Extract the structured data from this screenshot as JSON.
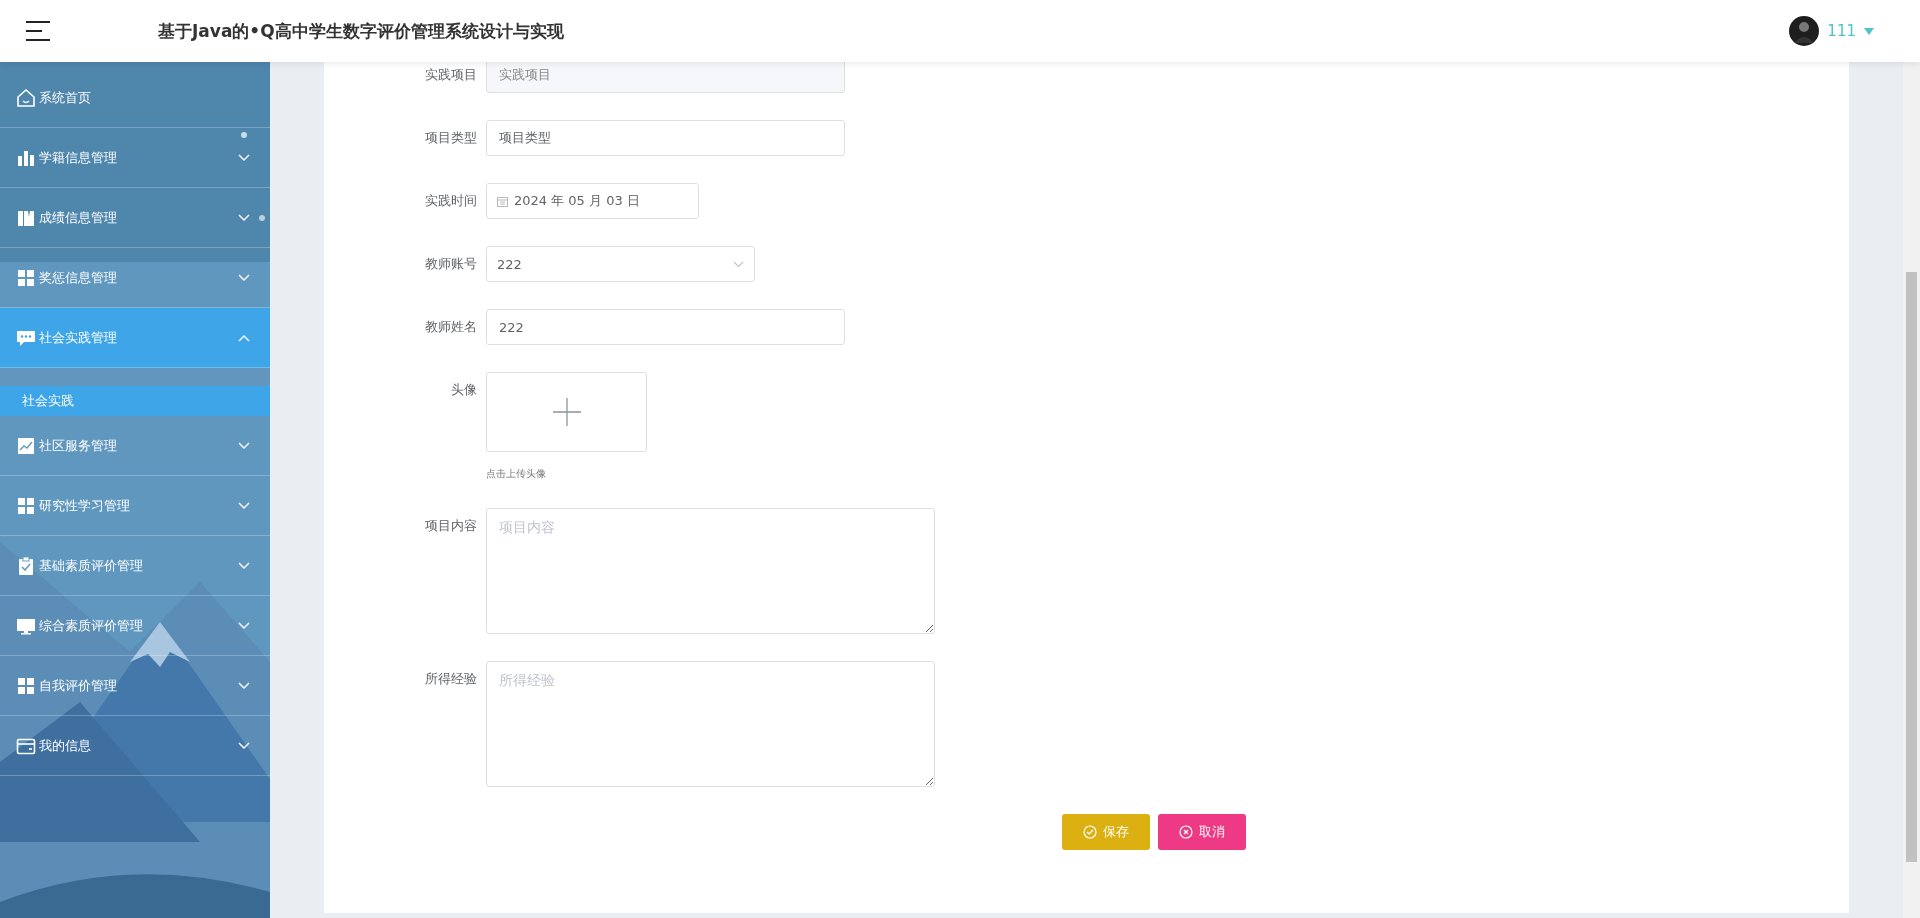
{
  "header": {
    "title": "基于Java的•Q高中学生数字评价管理系统设计与实现",
    "user": {
      "name": "111"
    }
  },
  "sidebar": {
    "items": [
      {
        "label": "系统首页",
        "kind": "link",
        "selected": false
      },
      {
        "label": "学籍信息管理",
        "kind": "group",
        "expanded": false,
        "selected": false
      },
      {
        "label": "成绩信息管理",
        "kind": "group",
        "expanded": false,
        "selected": false
      },
      {
        "label": "奖惩信息管理",
        "kind": "group",
        "expanded": false,
        "selected": false
      },
      {
        "label": "社会实践管理",
        "kind": "group",
        "expanded": true,
        "selected": true,
        "children": [
          {
            "label": "社会实践",
            "selected": true
          }
        ]
      },
      {
        "label": "社区服务管理",
        "kind": "group",
        "expanded": false,
        "selected": false
      },
      {
        "label": "研究性学习管理",
        "kind": "group",
        "expanded": false,
        "selected": false
      },
      {
        "label": "基础素质评价管理",
        "kind": "group",
        "expanded": false,
        "selected": false
      },
      {
        "label": "综合素质评价管理",
        "kind": "group",
        "expanded": false,
        "selected": false
      },
      {
        "label": "自我评价管理",
        "kind": "group",
        "expanded": false,
        "selected": false
      },
      {
        "label": "我的信息",
        "kind": "group",
        "expanded": false,
        "selected": false
      }
    ]
  },
  "form": {
    "fields": [
      {
        "kind": "text",
        "label": "实践项目",
        "value": "实践项目",
        "disabled": true
      },
      {
        "kind": "text",
        "label": "项目类型",
        "value": "项目类型",
        "disabled": false
      },
      {
        "kind": "date",
        "label": "实践时间",
        "value": "2024 年 05 月 03 日"
      },
      {
        "kind": "select",
        "label": "教师账号",
        "value": "222"
      },
      {
        "kind": "text",
        "label": "教师姓名",
        "value": "222",
        "disabled": false
      },
      {
        "kind": "upload",
        "label": "头像",
        "hint": "点击上传头像"
      },
      {
        "kind": "textarea",
        "label": "项目内容",
        "placeholder": "项目内容"
      },
      {
        "kind": "textarea",
        "label": "所得经验",
        "placeholder": "所得经验"
      }
    ],
    "buttons": [
      {
        "kind": "save",
        "label": "保存"
      },
      {
        "kind": "cancel",
        "label": "取消"
      }
    ]
  }
}
